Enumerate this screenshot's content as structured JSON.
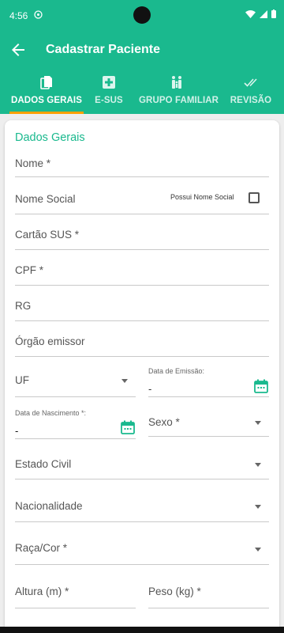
{
  "status": {
    "time": "4:56"
  },
  "appbar": {
    "title": "Cadastrar Paciente"
  },
  "tabs": [
    {
      "label": "DADOS GERAIS",
      "icon": "document-copy-icon",
      "active": true
    },
    {
      "label": "E-SUS",
      "icon": "medical-cross-icon",
      "active": false
    },
    {
      "label": "GRUPO FAMILIAR",
      "icon": "family-icon",
      "active": false
    },
    {
      "label": "REVISÃO",
      "icon": "double-check-icon",
      "active": false
    }
  ],
  "colors": {
    "primary": "#1ab98e",
    "tab_indicator": "#ffa000"
  },
  "form": {
    "section_title": "Dados Gerais",
    "nome": "Nome *",
    "nome_social": "Nome Social",
    "possui_nome_social": "Possui Nome Social",
    "cartao_sus": "Cartão SUS *",
    "cpf": "CPF *",
    "rg": "RG",
    "orgao_emissor": "Órgão emissor",
    "uf": "UF",
    "data_emissao": {
      "label": "Data de Emissão:",
      "value": "-"
    },
    "data_nascimento": {
      "label": "Data de Nascimento *:",
      "value": "-"
    },
    "sexo": "Sexo *",
    "estado_civil": "Estado Civil",
    "nacionalidade": "Nacionalidade",
    "raca_cor": "Raça/Cor *",
    "altura": "Altura (m) *",
    "peso": "Peso (kg) *"
  }
}
